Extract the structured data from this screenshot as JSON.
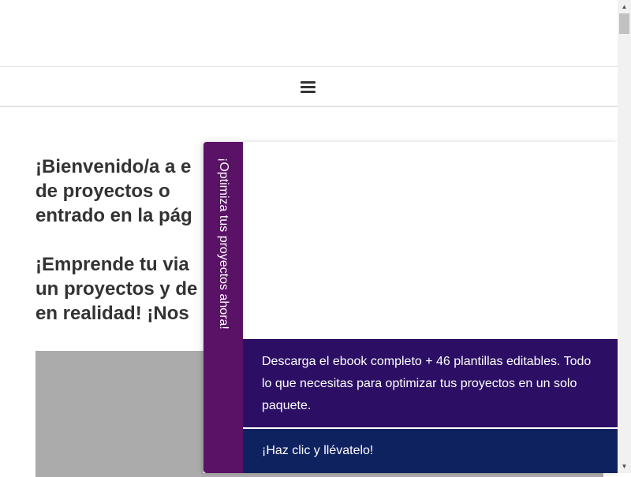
{
  "header": {
    "menu_icon": "hamburger-menu-icon"
  },
  "content": {
    "paragraph_1": "¡Bienvenido/a a el blog de gestión de proyectos o gestión de proyectos y acabas de entrado en la página ...",
    "paragraph_1_visible": "¡Bienvenido/a a e… de proyectos o … entrado en la pág…",
    "paragraph_2_visible": "¡Emprende tu via… un proyectos y de… en realidad! ¡Nos…"
  },
  "popup": {
    "side_tab_label": "¡Optimiza tus proyectos ahora!",
    "description": "Descarga el ebook completo + 46 plantillas editables. Todo lo que necesitas para optimizar tus proyectos en un solo paquete.",
    "cta_label": "¡Haz clic y llévatelo!",
    "colors": {
      "tab": "#5a1266",
      "description_bg": "#2c0f64",
      "cta_bg": "#0f2260"
    }
  },
  "scrollbar": {
    "up_icon": "scroll-up-arrow-icon",
    "down_icon": "scroll-down-arrow-icon"
  }
}
